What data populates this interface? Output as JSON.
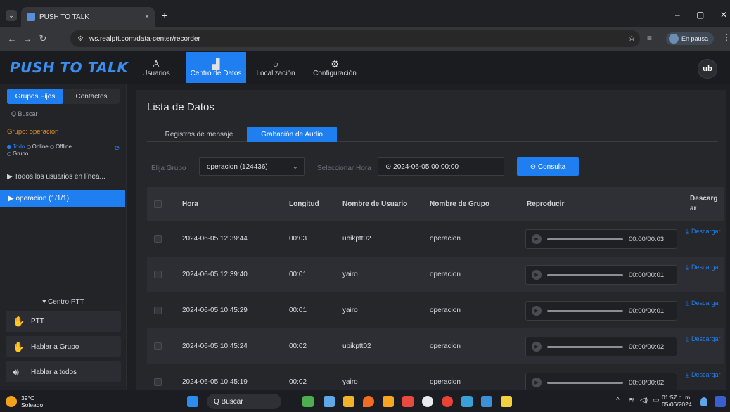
{
  "browser": {
    "tab_title": "PUSH TO TALK",
    "tab_close": "×",
    "new_tab": "+",
    "url": "ws.realptt.com/data-center/recorder",
    "profile_label": "En pausa",
    "window_controls": [
      "–",
      "▢",
      "✕"
    ]
  },
  "header": {
    "logo": "PUSH TO TALK",
    "nav": [
      {
        "label": "Usuarios",
        "icon": "user-icon"
      },
      {
        "label": "Centro de Datos",
        "icon": "bar-chart-icon",
        "active": true
      },
      {
        "label": "Localización",
        "icon": "location-pin-icon"
      },
      {
        "label": "Configuración",
        "icon": "gear-icon"
      }
    ],
    "user_initials": "ub"
  },
  "sidebar": {
    "tabs": [
      "Grupos Fijos",
      "Contactos"
    ],
    "search_placeholder": "Q Buscar",
    "group_label": "Grupo: operacion",
    "filters": {
      "todo": "Todo",
      "online": "Online",
      "offline": "Offline",
      "grupo": "Grupo"
    },
    "tree_all": "▶ Todos los usuarios en línea...",
    "tree_selected": "▶ operacion (1/1/1)",
    "centro_label": "▾ Centro PTT",
    "ptt_buttons": [
      {
        "label": "PTT",
        "icon": "ptt-hand-icon"
      },
      {
        "label": "Hablar a Grupo",
        "icon": "group-talk-icon"
      },
      {
        "label": "Hablar a todos",
        "icon": "speaker-icon"
      }
    ]
  },
  "main": {
    "title": "Lista de Datos",
    "tabs": [
      "Registros de mensaje",
      "Grabación de Audio"
    ],
    "active_tab": 1,
    "filter_group_label": "Elija Grupo",
    "filter_group_value": "operacion (124436)",
    "filter_time_label": "Seleccionar Hora",
    "filter_time_value": "⊙ 2024-06-05 00:00:00",
    "query_button": "⊙ Consulta",
    "columns": [
      "Hora",
      "Longitud",
      "Nombre de Usuario",
      "Nombre de Grupo",
      "Reproducir",
      "Descargar"
    ],
    "download_label": "Descargar",
    "rows": [
      {
        "hora": "2024-06-05 12:39:44",
        "longitud": "00:03",
        "usuario": "ubikptt02",
        "grupo": "operacion",
        "tiempo": "00:00/00:03"
      },
      {
        "hora": "2024-06-05 12:39:40",
        "longitud": "00:01",
        "usuario": "yairo",
        "grupo": "operacion",
        "tiempo": "00:00/00:01"
      },
      {
        "hora": "2024-06-05 10:45:29",
        "longitud": "00:01",
        "usuario": "yairo",
        "grupo": "operacion",
        "tiempo": "00:00/00:01"
      },
      {
        "hora": "2024-06-05 10:45:24",
        "longitud": "00:02",
        "usuario": "ubikptt02",
        "grupo": "operacion",
        "tiempo": "00:00/00:02"
      },
      {
        "hora": "2024-06-05 10:45:19",
        "longitud": "00:02",
        "usuario": "yairo",
        "grupo": "operacion",
        "tiempo": "00:00/00:02"
      }
    ]
  },
  "taskbar": {
    "temp": "39°C",
    "weather": "Soleado",
    "search": "Q  Buscar",
    "time": "01:57 p. m.",
    "date": "05/06/2024"
  }
}
